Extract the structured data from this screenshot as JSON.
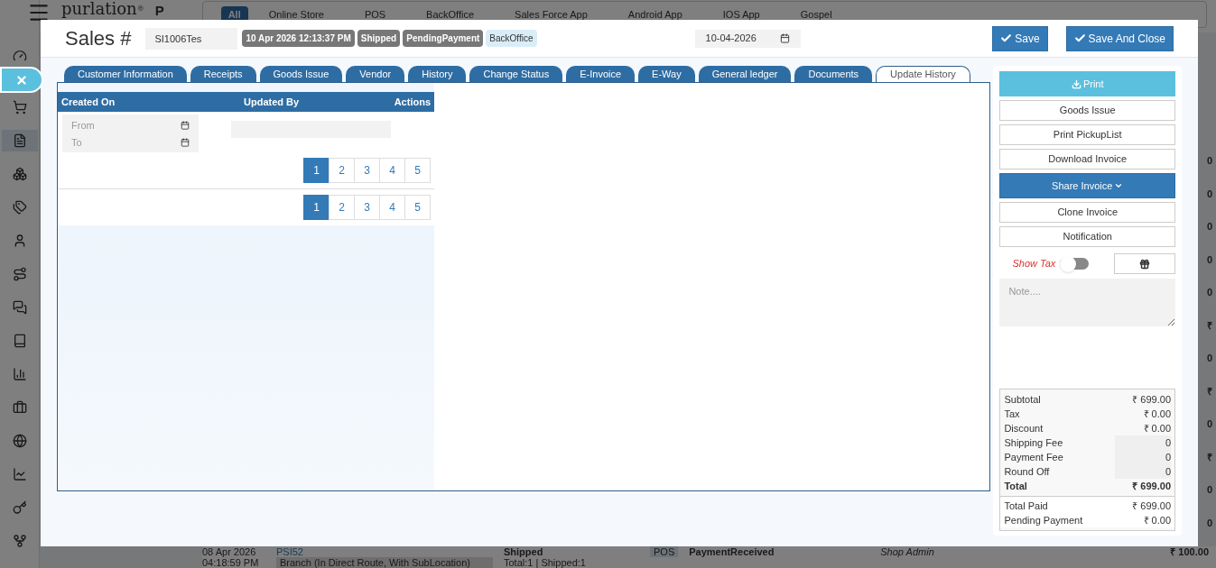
{
  "background": {
    "logo": "purlation",
    "logo_mark": "®",
    "logo_tail": "P",
    "channel_tabs": [
      {
        "label": "All",
        "selected": true
      },
      {
        "label": "Online Store",
        "selected": false
      },
      {
        "label": "POS",
        "selected": false
      },
      {
        "label": "BackOffice",
        "selected": false
      },
      {
        "label": "Sales Force App",
        "selected": false
      },
      {
        "label": "Android App",
        "selected": false
      },
      {
        "label": "IOS App",
        "selected": false
      },
      {
        "label": "Gospel",
        "selected": false
      }
    ],
    "sidebar": [
      {
        "selected": false
      },
      {
        "selected": false
      },
      {
        "selected": true
      },
      {
        "selected": false
      },
      {
        "selected": false
      },
      {
        "selected": false
      },
      {
        "selected": false
      },
      {
        "selected": false
      },
      {
        "selected": false
      },
      {
        "selected": false
      },
      {
        "selected": false
      },
      {
        "selected": false
      },
      {
        "selected": false
      },
      {
        "selected": false
      },
      {
        "selected": false
      }
    ],
    "edge_values": [
      "0",
      "0",
      "0",
      "0",
      "0",
      "₹",
      "0",
      "₹",
      "0",
      "₹",
      "0",
      "0"
    ],
    "last_row": {
      "date": "08 Apr 2026",
      "time": "04:18:59 PM",
      "number": "PSI52",
      "branch": "Branch (In Direct Route, With SubLocation)",
      "status": "Shipped",
      "counts": "Total:1 | Shipped:1",
      "channel": "POS",
      "payment": "PaymentReceived",
      "user": "Shop Admin",
      "amount": "₹ 100.00"
    }
  },
  "modal": {
    "title": "Sales #",
    "number": "SI1006Tes",
    "badges": [
      {
        "text": "10 Apr 2026 12:13:37 PM",
        "kind": "dark"
      },
      {
        "text": "Shipped",
        "kind": "dark"
      },
      {
        "text": "PendingPayment",
        "kind": "dark"
      },
      {
        "text": "BackOffice",
        "kind": "light"
      }
    ],
    "date": "10-04-2026",
    "buttons": [
      "Save",
      "Save And Close"
    ],
    "tabs": [
      {
        "label": "Customer Information",
        "selected": false
      },
      {
        "label": "Receipts",
        "selected": false
      },
      {
        "label": "Goods Issue",
        "selected": false
      },
      {
        "label": "Vendor",
        "selected": false
      },
      {
        "label": "History",
        "selected": false
      },
      {
        "label": "Change Status",
        "selected": false
      },
      {
        "label": "E-Invoice",
        "selected": false
      },
      {
        "label": "E-Way",
        "selected": false
      },
      {
        "label": "General ledger",
        "selected": false
      },
      {
        "label": "Documents",
        "selected": false
      },
      {
        "label": "Update History",
        "selected": true
      }
    ],
    "table": {
      "columns": [
        "Created On",
        "Updated By",
        "Actions"
      ],
      "from_placeholder": "From",
      "to_placeholder": "To",
      "pagers": [
        [
          {
            "label": "1",
            "selected": true
          },
          {
            "label": "2",
            "selected": false
          },
          {
            "label": "3",
            "selected": false
          },
          {
            "label": "4",
            "selected": false
          },
          {
            "label": "5",
            "selected": false
          }
        ],
        [
          {
            "label": "1",
            "selected": true
          },
          {
            "label": "2",
            "selected": false
          },
          {
            "label": "3",
            "selected": false
          },
          {
            "label": "4",
            "selected": false
          },
          {
            "label": "5",
            "selected": false
          }
        ]
      ]
    },
    "side": {
      "actions": [
        {
          "label": "Print",
          "kind": "print"
        },
        {
          "label": "Goods Issue",
          "kind": "plain"
        },
        {
          "label": "Print PickupList",
          "kind": "plain"
        },
        {
          "label": "Download Invoice",
          "kind": "plain"
        },
        {
          "label": "Share Invoice",
          "kind": "dropdown"
        },
        {
          "label": "Clone Invoice",
          "kind": "plain"
        },
        {
          "label": "Notification",
          "kind": "plain"
        }
      ],
      "show_tax": {
        "label": "Show Tax",
        "on": false
      },
      "note_placeholder": "Note....",
      "totals": [
        {
          "label": "Subtotal",
          "value": "₹ 699.00",
          "kind": "text"
        },
        {
          "label": "Tax",
          "value": "₹ 0.00",
          "kind": "text"
        },
        {
          "label": "Discount",
          "value": "₹ 0.00",
          "kind": "text"
        },
        {
          "label": "Shipping Fee",
          "value": "0",
          "kind": "input"
        },
        {
          "label": "Payment Fee",
          "value": "0",
          "kind": "input"
        },
        {
          "label": "Round Off",
          "value": "0",
          "kind": "input"
        },
        {
          "label": "Total",
          "value": "₹ 699.00",
          "kind": "total"
        }
      ],
      "paid": [
        {
          "label": "Total Paid",
          "value": "₹ 699.00"
        },
        {
          "label": "Pending Payment",
          "value": "₹ 0.00"
        }
      ]
    }
  }
}
